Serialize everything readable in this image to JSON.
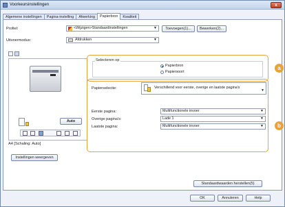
{
  "window": {
    "title": "Voorkeursinstellingen",
    "close_label": "x"
  },
  "tabs": [
    "Algemene instellingen",
    "Pagina-instelling",
    "Afwerking",
    "Papierbron",
    "Kwaliteit"
  ],
  "profile": {
    "label": "Profiel:",
    "value": "<Wijzigen>Standaardinstellingen",
    "add_button": "Toevoegen(1)...",
    "edit_button": "Bewerken(2)..."
  },
  "output": {
    "label": "Uitvoermodus:",
    "value": "Afdrukken"
  },
  "select_on": {
    "legend": "Selecteren op",
    "options": [
      "Papierbron",
      "Papiersoort"
    ],
    "selected": "Papierbron"
  },
  "paper_selection": {
    "label": "Papierselectie:",
    "value": "Verschillend voor eerste, overige en laatste pagina's"
  },
  "pages": [
    {
      "label": "Eerste pagina:",
      "value": "Multifunctionele invoer"
    },
    {
      "label": "Overige pagina's:",
      "value": "Lade 1"
    },
    {
      "label": "Laatste pagina:",
      "value": "Multifunctionele invoer"
    }
  ],
  "preview": {
    "auto_button": "Auto",
    "status": "A4 [Schaling: Auto]"
  },
  "view_settings_button": "Instellingen weergeven",
  "restore_defaults_button": "Standaardwaarden herstellen(5)",
  "footer": {
    "ok": "OK",
    "cancel": "Annuleren",
    "help": "Help"
  },
  "callouts": {
    "a": "a",
    "b": "b"
  }
}
